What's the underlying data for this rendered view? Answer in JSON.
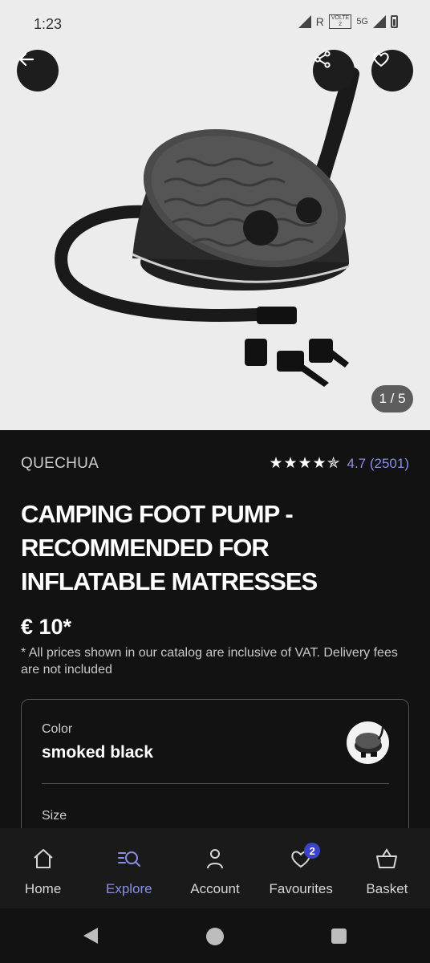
{
  "status_bar": {
    "time": "1:23",
    "roaming": "R",
    "volte": "VOLTE",
    "volte_slot": "2",
    "network": "5G"
  },
  "hero": {
    "pager_text": "1 / 5",
    "icons": {
      "back": "arrow-left-icon",
      "share": "share-icon",
      "favourite": "heart-outline-icon"
    }
  },
  "product": {
    "brand": "QUECHUA",
    "stars": "★★★★✯",
    "rating": 4.7,
    "rating_text": "4.7 (2501)",
    "title": "CAMPING FOOT PUMP - RECOMMENDED FOR INFLATABLE MATRESSES",
    "price": "€ 10*",
    "vat_note": "* All prices shown in our catalog are inclusive of VAT. Delivery fees are not included"
  },
  "options": {
    "color_label": "Color",
    "color_value": "smoked black",
    "size_label": "Size"
  },
  "bottom_nav": {
    "items": [
      {
        "label": "Home",
        "icon": "home-icon",
        "active": false
      },
      {
        "label": "Explore",
        "icon": "explore-icon",
        "active": true
      },
      {
        "label": "Account",
        "icon": "person-icon",
        "active": false
      },
      {
        "label": "Favourites",
        "icon": "heart-icon",
        "active": false,
        "badge": "2"
      },
      {
        "label": "Basket",
        "icon": "basket-icon",
        "active": false
      }
    ]
  },
  "colors": {
    "accent": "#8a8fe6",
    "badge": "#3a43c9",
    "background": "#121212",
    "hero_bg": "#ececec"
  }
}
